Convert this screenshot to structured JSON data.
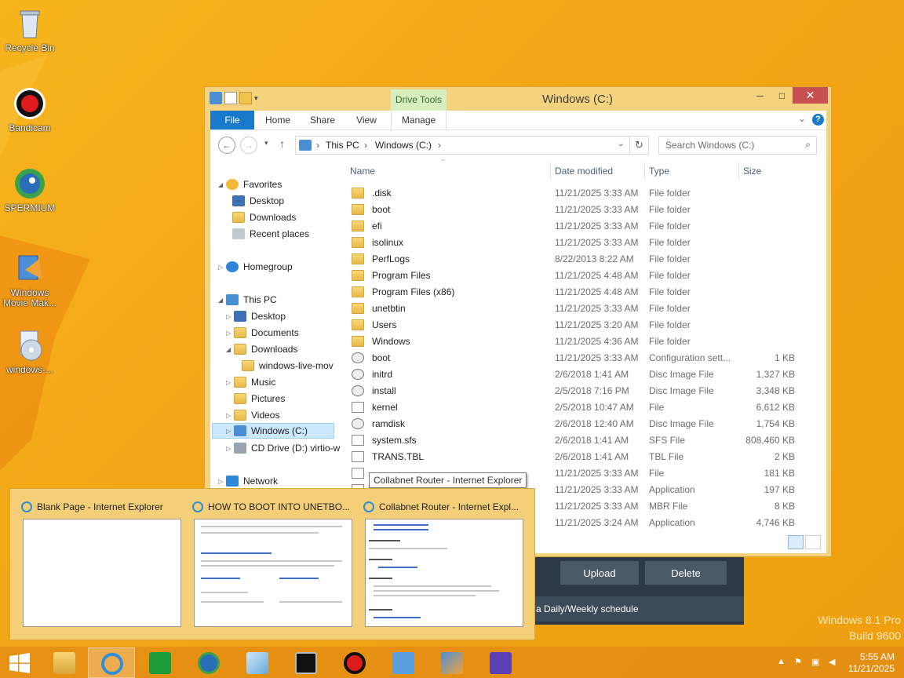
{
  "desktop": {
    "icons": [
      {
        "label": "Recycle Bin"
      },
      {
        "label": "Bandicam"
      },
      {
        "label": "SPERMIUM"
      },
      {
        "label": "Windows Movie Mak..."
      },
      {
        "label": "windows-..."
      }
    ]
  },
  "watermark": {
    "line1": "Windows 8.1 Pro",
    "line2": "Build 9600"
  },
  "background_app": {
    "upload": "Upload",
    "delete": "Delete",
    "schedule": "a Daily/Weekly schedule"
  },
  "explorer": {
    "title": "Windows (C:)",
    "contextual_tab": "Drive Tools",
    "tabs": [
      "File",
      "Home",
      "Share",
      "View",
      "Manage"
    ],
    "address": {
      "seg1": "This PC",
      "seg2": "Windows (C:)"
    },
    "search_placeholder": "Search Windows (C:)",
    "columns": {
      "name": "Name",
      "date": "Date modified",
      "type": "Type",
      "size": "Size"
    },
    "nav": [
      {
        "label": "Favorites"
      },
      {
        "label": "Desktop"
      },
      {
        "label": "Downloads"
      },
      {
        "label": "Recent places"
      },
      {
        "label": "Homegroup"
      },
      {
        "label": "This PC"
      },
      {
        "label": "Desktop"
      },
      {
        "label": "Documents"
      },
      {
        "label": "Downloads"
      },
      {
        "label": "windows-live-mov"
      },
      {
        "label": "Music"
      },
      {
        "label": "Pictures"
      },
      {
        "label": "Videos"
      },
      {
        "label": "Windows (C:)"
      },
      {
        "label": "CD Drive (D:) virtio-w"
      },
      {
        "label": "Network"
      }
    ],
    "files": [
      {
        "name": ".disk",
        "date": "11/21/2025 3:33 AM",
        "type": "File folder",
        "size": "",
        "icon": "folder"
      },
      {
        "name": "boot",
        "date": "11/21/2025 3:33 AM",
        "type": "File folder",
        "size": "",
        "icon": "folder"
      },
      {
        "name": "efi",
        "date": "11/21/2025 3:33 AM",
        "type": "File folder",
        "size": "",
        "icon": "folder"
      },
      {
        "name": "isolinux",
        "date": "11/21/2025 3:33 AM",
        "type": "File folder",
        "size": "",
        "icon": "folder"
      },
      {
        "name": "PerfLogs",
        "date": "8/22/2013 8:22 AM",
        "type": "File folder",
        "size": "",
        "icon": "folder"
      },
      {
        "name": "Program Files",
        "date": "11/21/2025 4:48 AM",
        "type": "File folder",
        "size": "",
        "icon": "folder"
      },
      {
        "name": "Program Files (x86)",
        "date": "11/21/2025 4:48 AM",
        "type": "File folder",
        "size": "",
        "icon": "folder"
      },
      {
        "name": "unetbtin",
        "date": "11/21/2025 3:33 AM",
        "type": "File folder",
        "size": "",
        "icon": "folder"
      },
      {
        "name": "Users",
        "date": "11/21/2025 3:20 AM",
        "type": "File folder",
        "size": "",
        "icon": "folder"
      },
      {
        "name": "Windows",
        "date": "11/21/2025 4:36 AM",
        "type": "File folder",
        "size": "",
        "icon": "folder"
      },
      {
        "name": "boot",
        "date": "11/21/2025 3:33 AM",
        "type": "Configuration sett...",
        "size": "1 KB",
        "icon": "gear"
      },
      {
        "name": "initrd",
        "date": "2/6/2018 1:41 AM",
        "type": "Disc Image File",
        "size": "1,327 KB",
        "icon": "disc"
      },
      {
        "name": "install",
        "date": "2/5/2018 7:16 PM",
        "type": "Disc Image File",
        "size": "3,348 KB",
        "icon": "disc"
      },
      {
        "name": "kernel",
        "date": "2/5/2018 10:47 AM",
        "type": "File",
        "size": "6,612 KB",
        "icon": "file"
      },
      {
        "name": "ramdisk",
        "date": "2/6/2018 12:40 AM",
        "type": "Disc Image File",
        "size": "1,754 KB",
        "icon": "disc"
      },
      {
        "name": "system.sfs",
        "date": "2/6/2018 1:41 AM",
        "type": "SFS File",
        "size": "808,460 KB",
        "icon": "file"
      },
      {
        "name": "TRANS.TBL",
        "date": "2/6/2018 1:41 AM",
        "type": "TBL File",
        "size": "2 KB",
        "icon": "file"
      },
      {
        "name": "",
        "date": "11/21/2025 3:33 AM",
        "type": "File",
        "size": "181 KB",
        "icon": "file"
      },
      {
        "name": "",
        "date": "11/21/2025 3:33 AM",
        "type": "Application",
        "size": "197 KB",
        "icon": "file"
      },
      {
        "name": "",
        "date": "11/21/2025 3:33 AM",
        "type": "MBR File",
        "size": "8 KB",
        "icon": "file"
      },
      {
        "name": "",
        "date": "11/21/2025 3:24 AM",
        "type": "Application",
        "size": "4,746 KB",
        "icon": "file"
      }
    ]
  },
  "tooltip": "Collabnet Router - Internet Explorer",
  "thumbnails": [
    {
      "title": "Blank Page - Internet Explorer"
    },
    {
      "title": "HOW TO BOOT INTO UNETBO..."
    },
    {
      "title": "Collabnet Router - Internet Expl..."
    }
  ],
  "taskbar": {
    "clock_time": "5:55 AM",
    "clock_date": "11/21/2025",
    "apps": [
      "start",
      "file-explorer",
      "internet-explorer",
      "store",
      "spermium",
      "notepad",
      "cmd",
      "bandicam",
      "network-monitor",
      "movie-maker",
      "settings"
    ]
  }
}
